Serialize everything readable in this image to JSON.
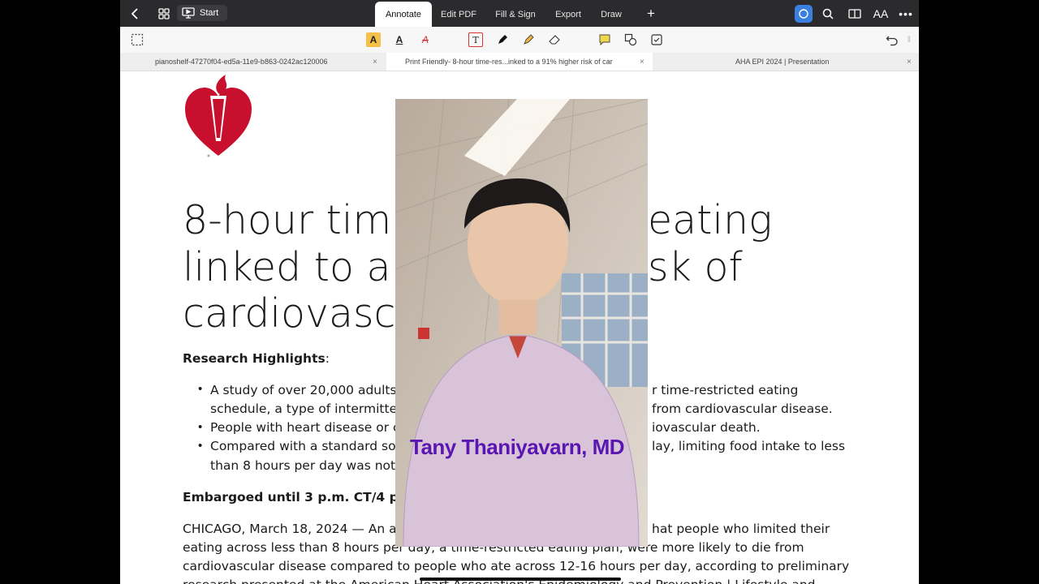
{
  "toolbar": {
    "start_label": "Start",
    "tabs": [
      {
        "label": "Annotate"
      },
      {
        "label": "Edit PDF"
      },
      {
        "label": "Fill & Sign"
      },
      {
        "label": "Export"
      },
      {
        "label": "Draw"
      }
    ],
    "active_tab": "Annotate",
    "font_size_label": "AA"
  },
  "document_tabs": [
    {
      "label": "pianoshelf-47270f04-ed5a-11e9-b863-0242ac120006"
    },
    {
      "label": "Print Friendly- 8-hour time-res...inked to a 91% higher risk of car"
    },
    {
      "label": "AHA EPI 2024 | Presentation"
    }
  ],
  "colors": {
    "accent": "#3b7fe0",
    "logo_red": "#c8102e",
    "caption": "#5a16b0"
  },
  "article": {
    "headline_lines": [
      "8-hour tim",
      "linked to a",
      "cardiovascu"
    ],
    "headline_right": [
      "eating",
      "sk of"
    ],
    "highlights_heading": "Research Highlights",
    "highlights_colon": ":",
    "bullets": [
      {
        "left": "A study of over 20,000 adults",
        "right": "r time-restricted eating"
      },
      {
        "left": "schedule, a type of intermitte",
        "right": "from cardiovascular disease."
      },
      {
        "left": "People with heart disease or c",
        "right": "iovascular death."
      },
      {
        "left": "Compared with a standard so",
        "right": "lay, limiting food intake to less"
      },
      {
        "left": "than 8 hours per day was not",
        "right": ""
      }
    ],
    "embargo": "Embargoed until 3 p.m. CT/4 p.m",
    "p1_left": "CHICAGO, March 18, 2024 — An ar",
    "p1_right": "hat people who limited their",
    "p2": "eating across less than 8 hours per day, a time-restricted eating plan, were more likely to die from",
    "p3": "cardiovascular disease compared to people who ate across 12-16 hours per day, according to preliminary",
    "p4": "research presented at the American Heart Association's Epidemiology and Prevention | Lifestyle and"
  },
  "video": {
    "caption": "Tany Thaniyavarn, MD"
  }
}
